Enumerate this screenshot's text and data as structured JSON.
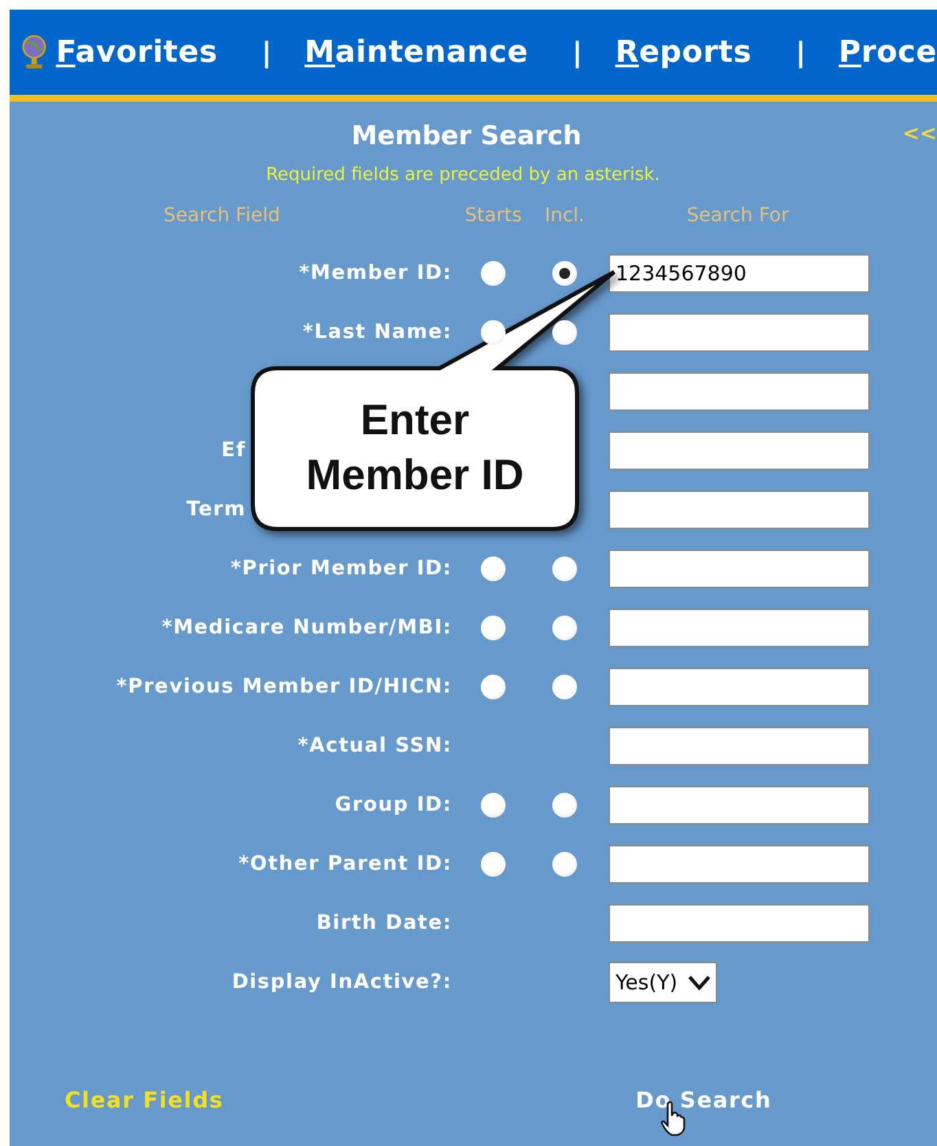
{
  "nav": {
    "items": [
      {
        "label": "Favorites"
      },
      {
        "label": "Maintenance"
      },
      {
        "label": "Reports"
      },
      {
        "label": "Proce"
      }
    ],
    "separator": "|"
  },
  "panel": {
    "title": "Member Search",
    "collapse": "<<",
    "note": "Required fields are preceded by an asterisk.",
    "headers": {
      "field": "Search Field",
      "starts": "Starts",
      "incl": "Incl.",
      "search_for": "Search For"
    },
    "rows": [
      {
        "kind": "text",
        "label": "*Member ID:",
        "starts": {
          "selected": false
        },
        "incl": {
          "selected": true
        },
        "value": "1234567890"
      },
      {
        "kind": "text",
        "label": "*Last Name:",
        "starts": {
          "selected": false
        },
        "incl": {
          "selected": false
        }
      },
      {
        "kind": "text"
      },
      {
        "kind": "text",
        "label": "Ef",
        "covered": true
      },
      {
        "kind": "text",
        "label": "Term",
        "covered": true
      },
      {
        "kind": "text",
        "label": "*Prior Member ID:",
        "starts": {
          "selected": false
        },
        "incl": {
          "selected": false
        }
      },
      {
        "kind": "text",
        "label": "*Medicare Number/MBI:",
        "starts": {
          "selected": false
        },
        "incl": {
          "selected": false
        }
      },
      {
        "kind": "text",
        "label": "*Previous Member ID/HICN:",
        "starts": {
          "selected": false
        },
        "incl": {
          "selected": false
        }
      },
      {
        "kind": "text",
        "label": "*Actual SSN:"
      },
      {
        "kind": "text",
        "label": "Group ID:",
        "starts": {
          "selected": false
        },
        "incl": {
          "selected": false
        }
      },
      {
        "kind": "text",
        "label": "*Other Parent ID:",
        "starts": {
          "selected": false
        },
        "incl": {
          "selected": false
        }
      },
      {
        "kind": "text",
        "label": "Birth Date:"
      },
      {
        "kind": "select",
        "label": "Display InActive?:",
        "value": "Yes(Y)"
      }
    ],
    "clear": "Clear Fields",
    "search": "Do Search"
  },
  "callout": {
    "text": "Enter Member ID"
  }
}
